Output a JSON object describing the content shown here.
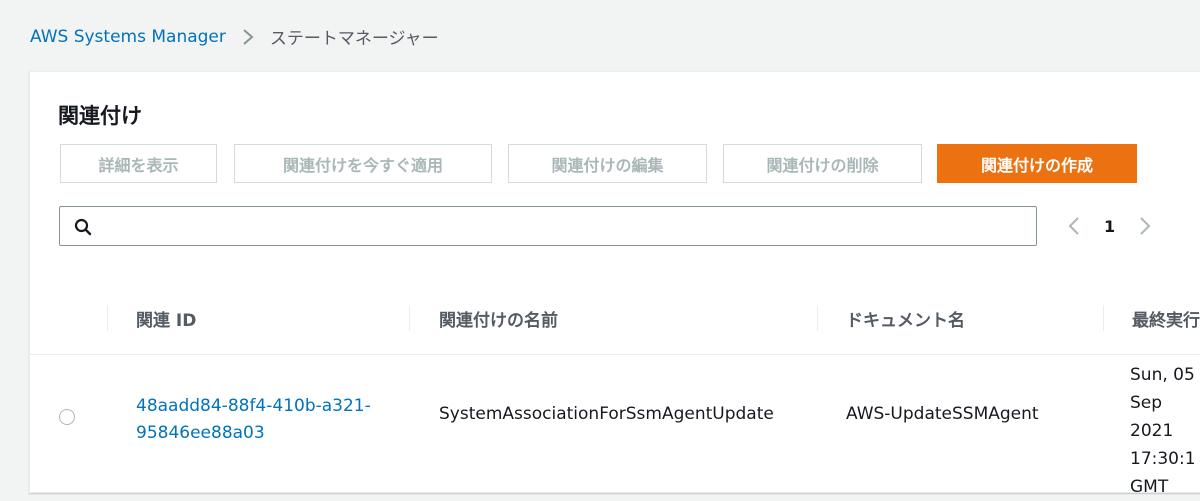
{
  "breadcrumb": {
    "service": "AWS Systems Manager",
    "current": "ステートマネージャー"
  },
  "panel": {
    "title": "関連付け"
  },
  "actions": {
    "view_details": "詳細を表示",
    "apply_now": "関連付けを今すぐ適用",
    "edit": "関連付けの編集",
    "delete": "関連付けの削除",
    "create": "関連付けの作成"
  },
  "search": {
    "value": "",
    "placeholder": ""
  },
  "pagination": {
    "current_page": "1"
  },
  "table": {
    "columns": [
      "関連 ID",
      "関連付けの名前",
      "ドキュメント名",
      "最終実行"
    ],
    "rows": [
      {
        "selected": false,
        "association_id": "48aadd84-88f4-410b-a321-95846ee88a03",
        "association_name": "SystemAssociationForSsmAgentUpdate",
        "document_name": "AWS-UpdateSSMAgent",
        "last_execution": "Sun, 05\nSep 2021\n17:30:1\nGMT"
      }
    ]
  },
  "colors": {
    "primary": "#ec7211",
    "link": "#0073bb",
    "disabled_text": "#aab7b8"
  }
}
